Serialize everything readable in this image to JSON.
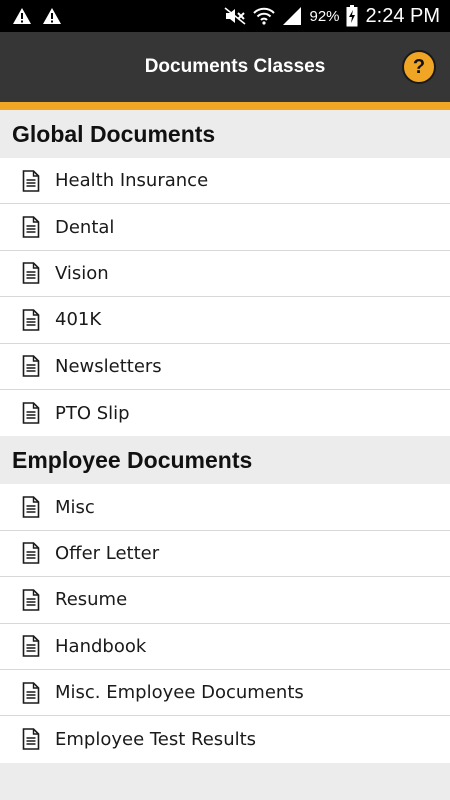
{
  "status_bar": {
    "battery_percent": "92%",
    "time": "2:24 PM"
  },
  "app_bar": {
    "title": "Documents Classes",
    "help_label": "?"
  },
  "sections": [
    {
      "title": "Global Documents",
      "items": [
        {
          "label": "Health Insurance"
        },
        {
          "label": "Dental"
        },
        {
          "label": "Vision"
        },
        {
          "label": "401K"
        },
        {
          "label": "Newsletters"
        },
        {
          "label": "PTO Slip"
        }
      ]
    },
    {
      "title": "Employee Documents",
      "items": [
        {
          "label": "Misc"
        },
        {
          "label": "Offer Letter"
        },
        {
          "label": "Resume"
        },
        {
          "label": "Handbook"
        },
        {
          "label": "Misc. Employee Documents"
        },
        {
          "label": "Employee Test Results"
        }
      ]
    }
  ],
  "colors": {
    "accent": "#f0a524",
    "app_bar": "#363636",
    "background": "#ececec"
  },
  "icons": {
    "list_item": "document-icon",
    "help": "help-icon"
  }
}
